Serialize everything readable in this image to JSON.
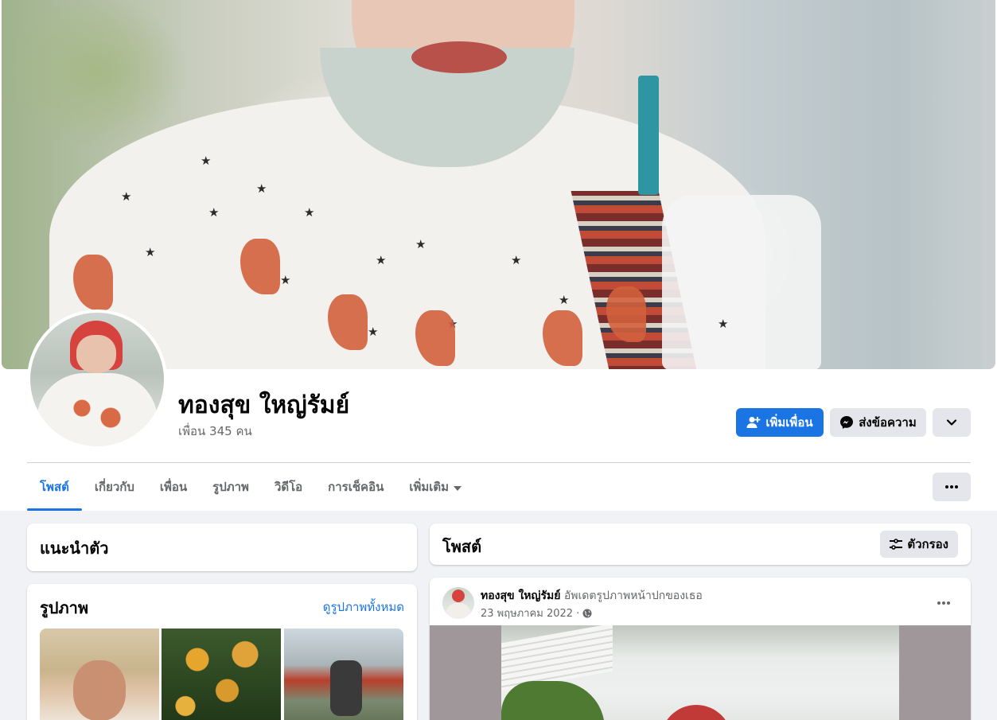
{
  "profile": {
    "name": "ทองสุข ใหญ่รัมย์",
    "friends_count": "เพื่อน 345 คน"
  },
  "actions": {
    "add_friend": "เพิ่มเพื่อน",
    "message": "ส่งข้อความ"
  },
  "tabs": [
    {
      "label": "โพสต์",
      "active": true
    },
    {
      "label": "เกี่ยวกับ"
    },
    {
      "label": "เพื่อน"
    },
    {
      "label": "รูปภาพ"
    },
    {
      "label": "วิดีโอ"
    },
    {
      "label": "การเช็คอิน"
    },
    {
      "label": "เพิ่มเติม"
    }
  ],
  "intro": {
    "title": "แนะนำตัว"
  },
  "photos": {
    "title": "รูปภาพ",
    "see_all": "ดูรูปภาพทั้งหมด"
  },
  "posts": {
    "title": "โพสต์",
    "filter_label": "ตัวกรอง"
  },
  "post": {
    "author": "ทองสุข ใหญ่รัมย์",
    "action": "อัพเดตรูปภาพหน้าปกของเธอ",
    "date": "23 พฤษภาคม 2022 ·"
  },
  "colors": {
    "accent": "#1b74e4",
    "background": "#f0f2f5",
    "secondary_button": "#e4e6eb",
    "muted_text": "#65676b"
  },
  "icons": {
    "add_friend": "person-plus-icon",
    "message": "messenger-icon",
    "more": "chevron-down-icon",
    "tab_more": "ellipsis-icon",
    "filter": "sliders-icon",
    "privacy": "globe-icon"
  }
}
